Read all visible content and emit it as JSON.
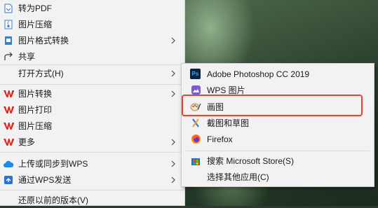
{
  "main_menu": {
    "items": [
      {
        "label": "转为PDF",
        "icon": "pdf-convert-icon"
      },
      {
        "label": "图片压缩",
        "icon": "zip-icon"
      },
      {
        "label": "图片格式转换",
        "icon": "format-convert-icon",
        "submenu": true
      },
      {
        "label": "共享",
        "icon": "share-icon"
      },
      {
        "label": "打开方式(H)",
        "icon": "",
        "submenu": true
      },
      {
        "label": "图片转换",
        "icon": "wps-icon",
        "submenu": true
      },
      {
        "label": "图片打印",
        "icon": "wps-icon"
      },
      {
        "label": "图片压缩",
        "icon": "wps-icon"
      },
      {
        "label": "更多",
        "icon": "wps-icon",
        "submenu": true
      },
      {
        "label": "上传或同步到WPS",
        "icon": "cloud-icon",
        "submenu": true
      },
      {
        "label": "通过WPS发送",
        "icon": "send-icon",
        "submenu": true
      },
      {
        "label": "还原以前的版本(V)",
        "icon": ""
      }
    ]
  },
  "open_with_menu": {
    "items": [
      {
        "label": "Adobe Photoshop CC 2019",
        "icon": "photoshop-icon",
        "icon_text": "Ps"
      },
      {
        "label": "WPS 图片",
        "icon": "wps-picture-icon"
      },
      {
        "label": "画图",
        "icon": "paint-icon"
      },
      {
        "label": "截图和草图",
        "icon": "snip-sketch-icon"
      },
      {
        "label": "Firefox",
        "icon": "firefox-icon"
      },
      {
        "label": "搜索 Microsoft Store(S)",
        "icon": "store-icon"
      },
      {
        "label": "选择其他应用(C)",
        "icon": ""
      }
    ]
  },
  "colors": {
    "menu_bg": "#f2f2f2",
    "highlight_border": "#e8452f",
    "wps_red": "#d9291c",
    "photoshop_bg": "#0b2440",
    "photoshop_fg": "#31a8ff"
  }
}
